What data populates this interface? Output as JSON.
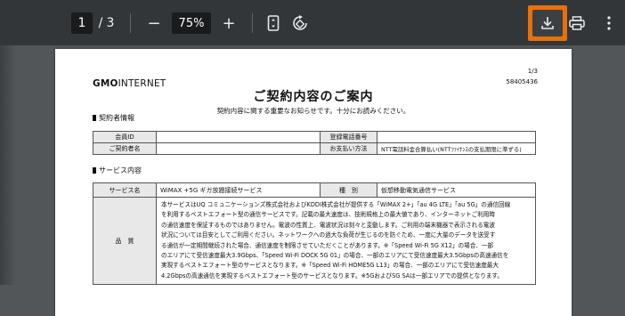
{
  "toolbar": {
    "current_page": "1",
    "page_separator": "/",
    "total_pages": "3",
    "zoom_out": "−",
    "zoom_level": "75%",
    "zoom_in": "+",
    "fit_icon": "fit-to-page-icon",
    "rotate_icon": "rotate-icon",
    "download_icon": "download-icon",
    "print_icon": "print-icon",
    "more_icon": "more-vert-icon",
    "download_highlight_color": "#e8710a"
  },
  "document": {
    "logo_bold": "GMO",
    "logo_rest": "INTERNET",
    "page_indicator": "1/3",
    "doc_number": "58405436",
    "title": "ご契約内容のご案内",
    "subtitle": "契約内容に関する重要なお知らせです。十分にお読みください。",
    "section1": "契約者情報",
    "contract_table": {
      "member_id_label": "会員ID",
      "member_id_value": "",
      "phone_label": "登録電話番号",
      "phone_value": "",
      "name_label": "ご契約者名",
      "name_value": "",
      "payment_label": "お支払い方法",
      "payment_value": "NTT電話料金合算払い(NTTﾌｧｲﾅﾝｽの支払期限に準ずる)"
    },
    "section2": "サービス内容",
    "service_table": {
      "service_name_label": "サービス名",
      "service_name_value": "WiMAX +5G ギガ放題接続サービス",
      "type_label": "種　別",
      "type_value": "仮想移動電気通信サービス",
      "quality_label": "品　質",
      "quality_lines": [
        "本サービスはUQ コミュニケーションズ株式会社およびKDDI株式会社が提供する「WiMAX 2+」「au 4G LTE」「au 5G」の通信回線",
        "を利用するベストエフォート型の通信サービスです。記載の最大速度は、技術規格上の最大値であり、インターネットご利用時",
        "の通信速度を保証するものではありません。電波の性質上、電波状況は刻々と変動します。ご利用の端末機器で表示される電波",
        "状況については目安としてご利用ください。ネットワークへの過大な負荷が生じるのを防ぐため、一度に大量のデータを送受す",
        "る通信が一定期間継続された場合、通信速度を制限させていただくことがあります。※「Speed Wi-Fi 5G X12」の場合、一部",
        "のエリアにて受信速度最大3.9Gbps、「Speed Wi-Fi DOCK 5G 01」の場合、一部のエリアにて受信速度最大3.5Gbpsの高速通信を",
        "実現するベストエフォート型のサービスとなります。※「Speed Wi-Fi HOME5G L13」の場合、一部のエリアにて受信速度最大",
        "4.2Gbpsの高速通信を実現するベストエフォート型のサービスとなります。※5GおよびSG SAは一部エリアでの提供となります。"
      ]
    }
  }
}
